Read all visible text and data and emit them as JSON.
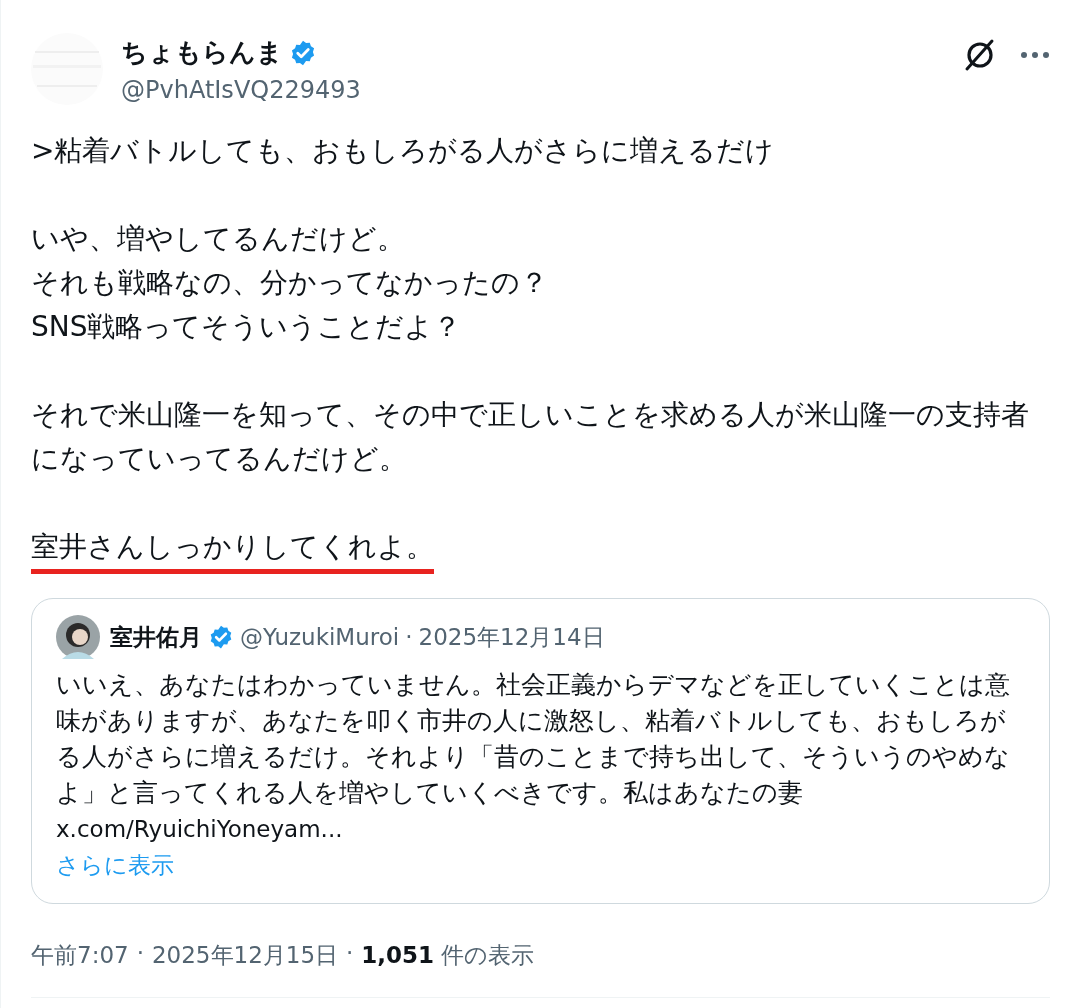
{
  "author": {
    "name": "ちょもらんま",
    "verified": true,
    "handle": "@PvhAtIsVQ229493"
  },
  "body": [
    {
      "lines": [
        ">粘着バトルしても、おもしろがる人がさらに増えるだけ"
      ],
      "underlined": false
    },
    {
      "lines": [
        "いや、増やしてるんだけど。",
        "それも戦略なの、分かってなかったの？",
        "SNS戦略ってそういうことだよ？"
      ],
      "underlined": false
    },
    {
      "lines": [
        "それで米山隆一を知って、その中で正しいことを求める人が米山隆一の支持者になっていってるんだけど。"
      ],
      "underlined": false
    },
    {
      "lines": [
        "室井さんしっかりしてくれよ。"
      ],
      "underlined": true
    }
  ],
  "quote": {
    "name": "室井佑月",
    "verified": true,
    "handle": "@YuzukiMuroi",
    "separator": "·",
    "date": "2025年12月14日",
    "text": "いいえ、あなたはわかっていません。社会正義からデマなどを正していくことは意味がありますが、あなたを叩く市井の人に激怒し、粘着バトルしても、おもしろがる人がさらに増えるだけ。それより「昔のことまで持ち出して、そういうのやめなよ」と言ってくれる人を増やしていくべきです。私はあなたの妻",
    "link": "x.com/RyuichiYoneyam...",
    "more": "さらに表示"
  },
  "meta": {
    "time": "午前7:07",
    "separator_1": "·",
    "date": "2025年12月15日",
    "separator_2": "·",
    "views": "**1,051** 件の表示"
  }
}
